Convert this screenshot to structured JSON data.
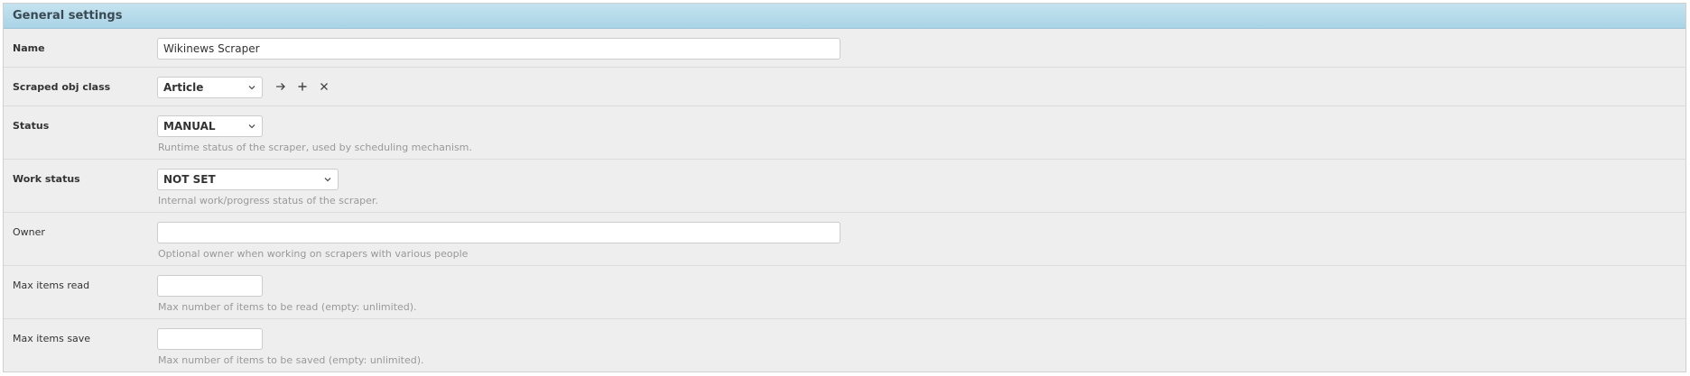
{
  "fieldset": {
    "title": "General settings"
  },
  "fields": {
    "name": {
      "label": "Name",
      "value": "Wikinews Scraper"
    },
    "scraped_obj_class": {
      "label": "Scraped obj class",
      "selected": "Article",
      "icons": [
        "arrow-right-icon",
        "plus-icon",
        "close-icon"
      ]
    },
    "status": {
      "label": "Status",
      "selected": "MANUAL",
      "help": "Runtime status of the scraper, used by scheduling mechanism."
    },
    "work_status": {
      "label": "Work status",
      "selected": "NOT SET",
      "help": "Internal work/progress status of the scraper."
    },
    "owner": {
      "label": "Owner",
      "value": "",
      "help": "Optional owner when working on scrapers with various people"
    },
    "max_items_read": {
      "label": "Max items read",
      "value": "",
      "help": "Max number of items to be read (empty: unlimited)."
    },
    "max_items_save": {
      "label": "Max items save",
      "value": "",
      "help": "Max number of items to be saved (empty: unlimited)."
    }
  },
  "colors": {
    "header_start": "#c5e3ef",
    "header_end": "#a9d4e6",
    "row_background": "#eeeeee",
    "help_text": "#999999"
  }
}
